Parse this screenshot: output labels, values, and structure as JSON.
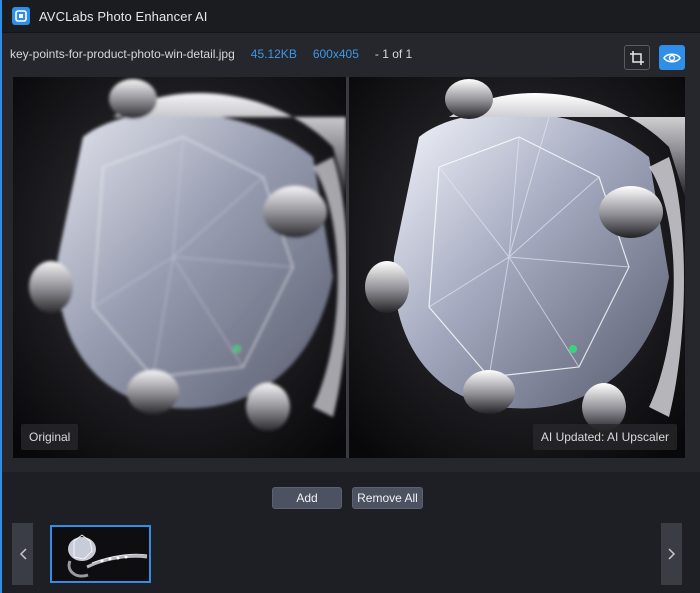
{
  "app": {
    "title": "AVCLabs Photo Enhancer AI",
    "accent_color": "#2f8fe6"
  },
  "file_info": {
    "name": "key-points-for-product-photo-win-detail.jpg",
    "size": "45.12KB",
    "dimensions": "600x405",
    "count": "- 1 of 1"
  },
  "toolbar": {
    "crop_icon": "crop-icon",
    "preview_icon": "eye-icon"
  },
  "preview": {
    "left_label": "Original",
    "right_label": "AI Updated: AI Upscaler"
  },
  "actions": {
    "add_label": "Add",
    "remove_all_label": "Remove All"
  },
  "thumbnails": {
    "prev_icon": "chevron-left-icon",
    "next_icon": "chevron-right-icon"
  }
}
